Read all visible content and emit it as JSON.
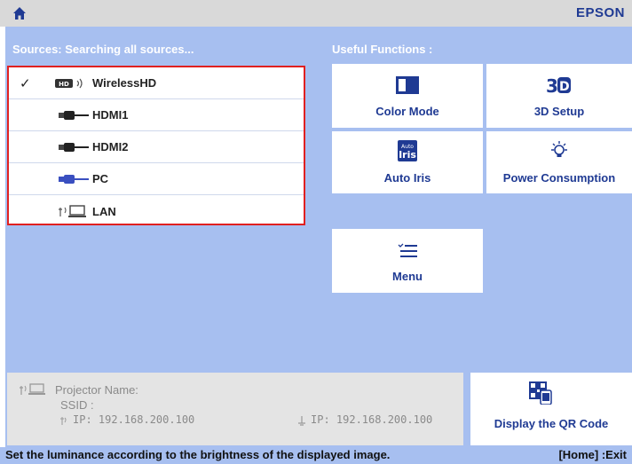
{
  "header": {
    "brand": "EPSON"
  },
  "sources": {
    "title": "Sources: Searching all sources...",
    "items": [
      {
        "label": "WirelessHD",
        "checked": true,
        "icon": "wirelesshd-icon"
      },
      {
        "label": "HDMI1",
        "checked": false,
        "icon": "hdmi-icon"
      },
      {
        "label": "HDMI2",
        "checked": false,
        "icon": "hdmi-icon"
      },
      {
        "label": "PC",
        "checked": false,
        "icon": "pc-vga-icon"
      },
      {
        "label": "LAN",
        "checked": false,
        "icon": "lan-icon"
      }
    ],
    "check_mark": "✓"
  },
  "functions": {
    "title": "Useful Functions :",
    "color_mode": "Color Mode",
    "setup_3d": "3D Setup",
    "auto_iris": "Auto Iris",
    "power": "Power Consumption",
    "menu": "Menu"
  },
  "network": {
    "projector_name_label": "Projector Name:",
    "ssid_label": "SSID :",
    "ip_wireless": "IP: 192.168.200.100",
    "ip_wired": "IP: 192.168.200.100"
  },
  "qr": {
    "label": "Display the QR Code"
  },
  "status": {
    "hint": "Set the luminance according to the brightness of the displayed image.",
    "exit": "[Home] :Exit"
  },
  "colors": {
    "panel_blue": "#a7bff0",
    "text_blue": "#1f3a93",
    "highlight_border": "#e02020"
  }
}
